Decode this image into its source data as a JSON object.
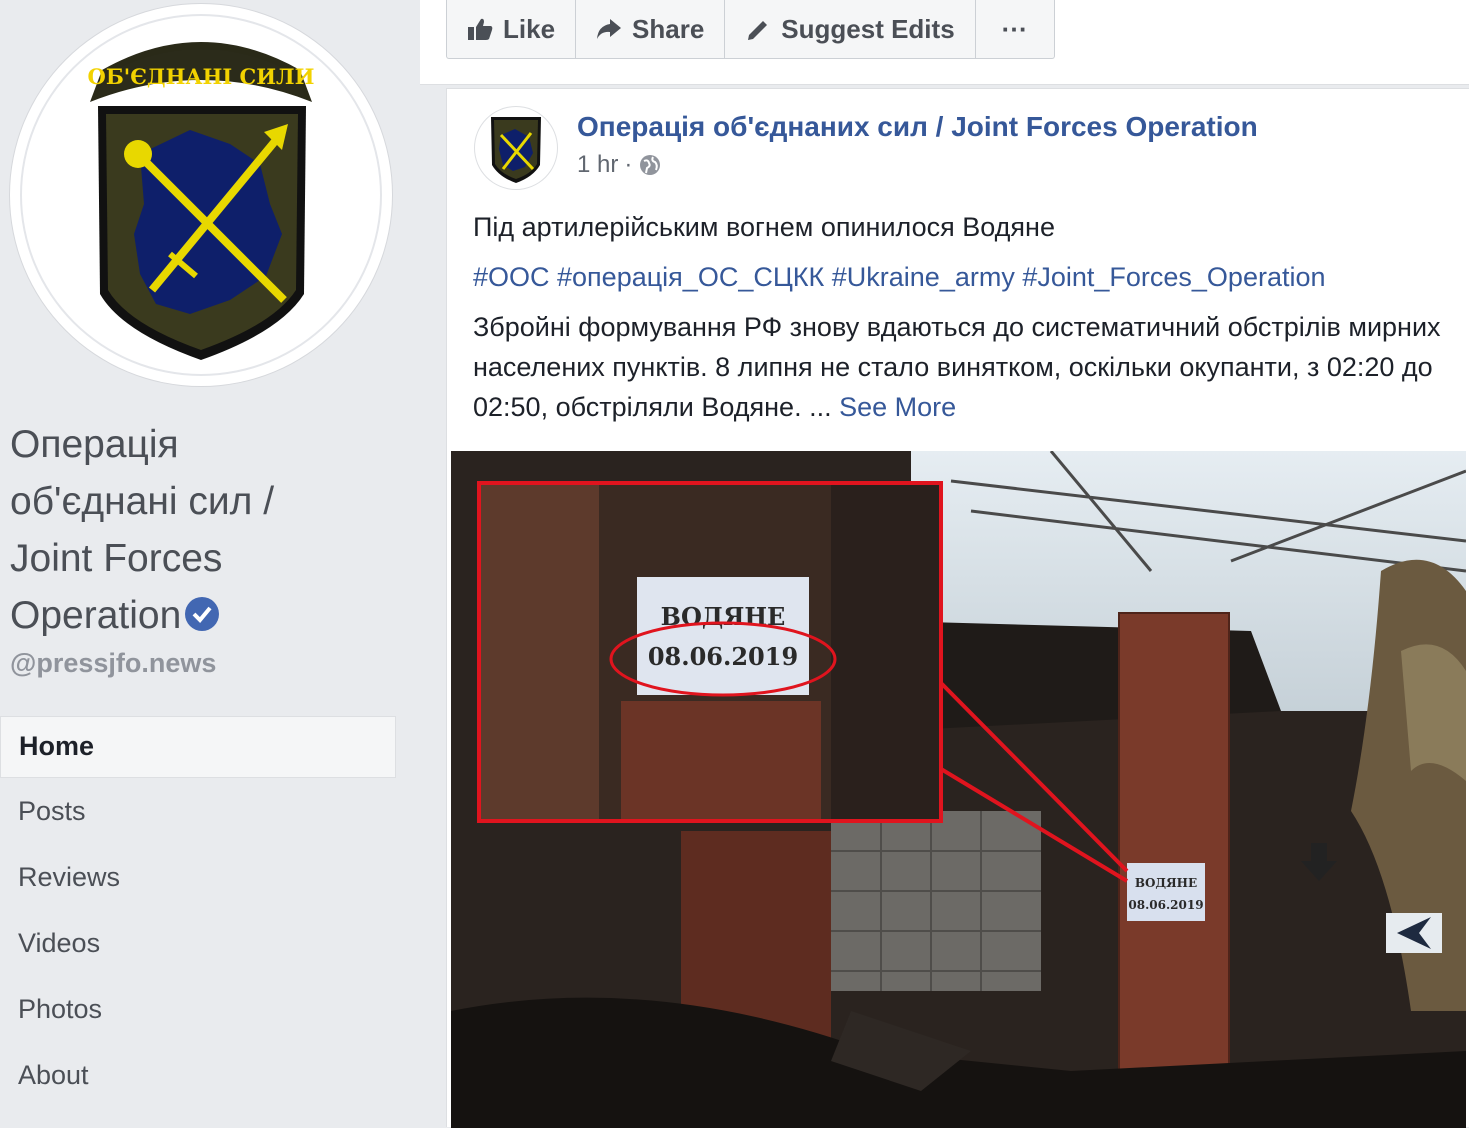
{
  "page": {
    "name": "Операція об'єднаних сил / Joint Forces Operation",
    "name_lines": [
      "Операція",
      "об'єднані сил /",
      "Joint Forces",
      "Operation"
    ],
    "handle": "@pressjfo.news",
    "emblem_text": "ОБ'ЄДНАНІ СИЛИ"
  },
  "nav": {
    "items": [
      {
        "label": "Home",
        "active": true
      },
      {
        "label": "Posts",
        "active": false
      },
      {
        "label": "Reviews",
        "active": false
      },
      {
        "label": "Videos",
        "active": false
      },
      {
        "label": "Photos",
        "active": false
      },
      {
        "label": "About",
        "active": false
      }
    ]
  },
  "actions": {
    "like": "Like",
    "share": "Share",
    "suggest": "Suggest Edits",
    "more": "···"
  },
  "post": {
    "author": "Операція об'єднаних сил / Joint Forces Operation",
    "time": "1 hr",
    "headline": "Під артилерійським вогнем опинилося Водяне",
    "hashtags": "#ООС #операція_ОС_СЦКК #Ukraine_army #Joint_Forces_Operation",
    "body": "Збройні формування РФ знову вдаються до систематичний обстрілів мирних населених пунктів. 8 липня не стало винятком, оскільки окупанти, з 02:20 до 02:50, обстріляли Водяне. ...",
    "see_more": "See More",
    "photo_sign_line1": "ВОДЯНЕ",
    "photo_sign_line2": "08.06.2019"
  },
  "colors": {
    "link": "#365899",
    "verified": "#4267b2",
    "annotation": "#e0141e"
  }
}
